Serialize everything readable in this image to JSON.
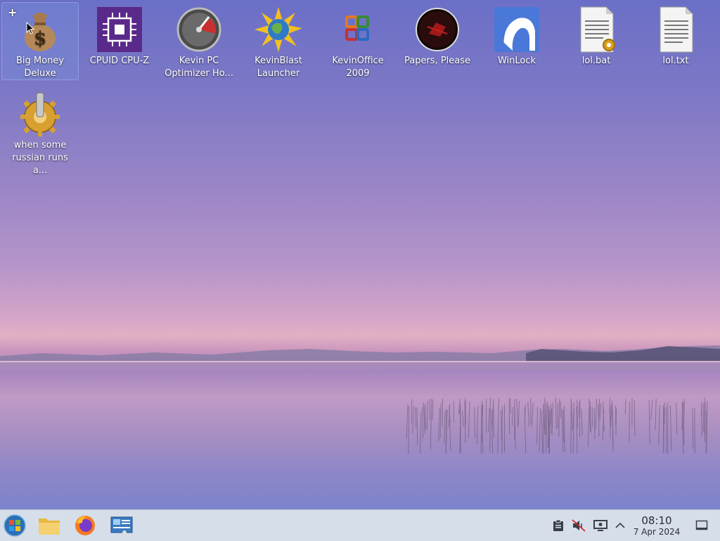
{
  "desktop": {
    "icons": [
      {
        "label": "Big Money Deluxe",
        "icon": "money-bag-icon"
      },
      {
        "label": "CPUID CPU-Z",
        "icon": "cpu-chip-icon"
      },
      {
        "label": "Kevin PC Optimizer Ho...",
        "icon": "speedometer-icon"
      },
      {
        "label": "KevinBlast Launcher",
        "icon": "starburst-globe-icon"
      },
      {
        "label": "KevinOffice 2009",
        "icon": "office-logo-icon"
      },
      {
        "label": "Papers, Please",
        "icon": "papers-please-icon"
      },
      {
        "label": "WinLock",
        "icon": "winlock-icon"
      },
      {
        "label": "lol.bat",
        "icon": "batch-file-icon"
      },
      {
        "label": "lol.txt",
        "icon": "text-file-icon"
      },
      {
        "label": "when some russian runs a...",
        "icon": "gear-icon"
      }
    ],
    "selected_badge": "+"
  },
  "taskbar": {
    "start": {
      "icon": "start-orb-icon"
    },
    "pinned": [
      {
        "icon": "file-manager-icon"
      },
      {
        "icon": "firefox-icon"
      },
      {
        "icon": "system-settings-icon"
      }
    ],
    "tray": [
      {
        "icon": "clipboard-icon"
      },
      {
        "icon": "volume-muted-icon"
      },
      {
        "icon": "display-icon"
      },
      {
        "icon": "chevron-up-icon"
      }
    ],
    "clock": {
      "time": "08:10",
      "date": "7 Apr 2024"
    },
    "show_desktop": {
      "icon": "show-desktop-icon"
    }
  },
  "colors": {
    "taskbar_bg": "#d6dee9",
    "selection": "#7896dc"
  }
}
